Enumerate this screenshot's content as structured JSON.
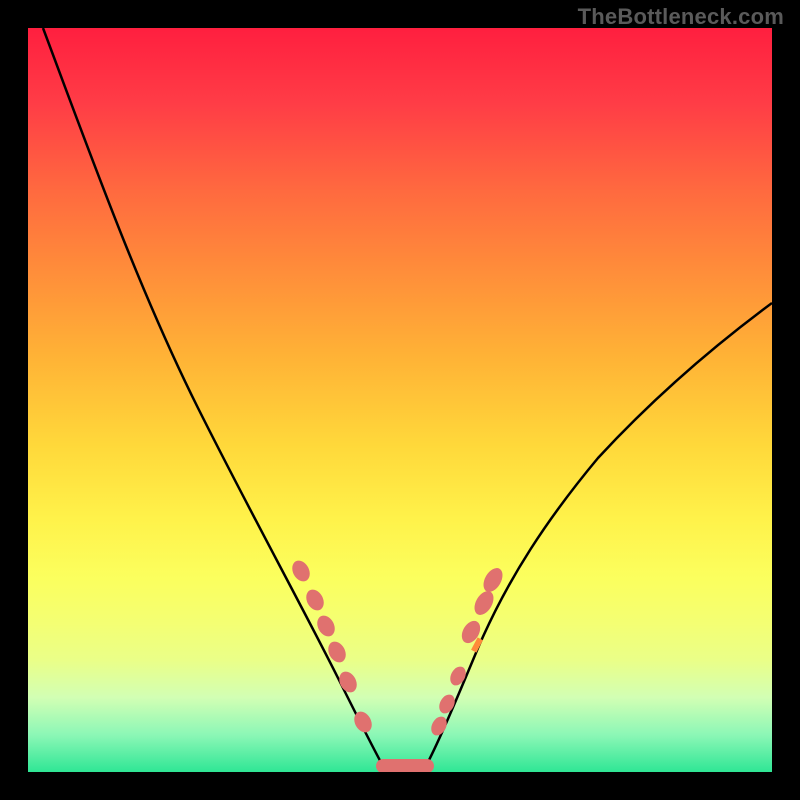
{
  "watermark": "TheBottleneck.com",
  "chart_data": {
    "type": "line",
    "title": "",
    "xlabel": "",
    "ylabel": "",
    "xlim": [
      0,
      100
    ],
    "ylim": [
      0,
      100
    ],
    "grid": false,
    "curve_left": {
      "x": [
        2,
        6,
        10,
        14,
        18,
        22,
        26,
        30,
        34,
        38,
        42,
        45,
        47
      ],
      "y": [
        100,
        92,
        83,
        74,
        65,
        56,
        48,
        40,
        32,
        24,
        14,
        6,
        2
      ]
    },
    "curve_right": {
      "x": [
        53,
        55,
        58,
        61,
        64,
        68,
        72,
        76,
        80,
        84,
        88,
        92,
        96,
        100
      ],
      "y": [
        2,
        6,
        12,
        18,
        24,
        30,
        36,
        41,
        46,
        50,
        54,
        58,
        61,
        64
      ]
    },
    "flat_segment": {
      "x": [
        47,
        53
      ],
      "y": [
        0,
        0
      ]
    },
    "markers_left": {
      "x": [
        36.5,
        38.5,
        40,
        41.5,
        43,
        45
      ],
      "y": [
        27,
        23,
        19.5,
        16,
        12,
        6
      ]
    },
    "markers_right": {
      "x": [
        55,
        56,
        57.5,
        59,
        61,
        62
      ],
      "y": [
        6,
        9,
        13,
        19,
        23,
        26
      ]
    },
    "markers_bottom": {
      "x": [
        47,
        48.5,
        50,
        51.5,
        53
      ],
      "y": [
        0.5,
        0.5,
        0.5,
        0.5,
        0.5
      ]
    },
    "notch": {
      "x": 60,
      "y": 17
    }
  }
}
